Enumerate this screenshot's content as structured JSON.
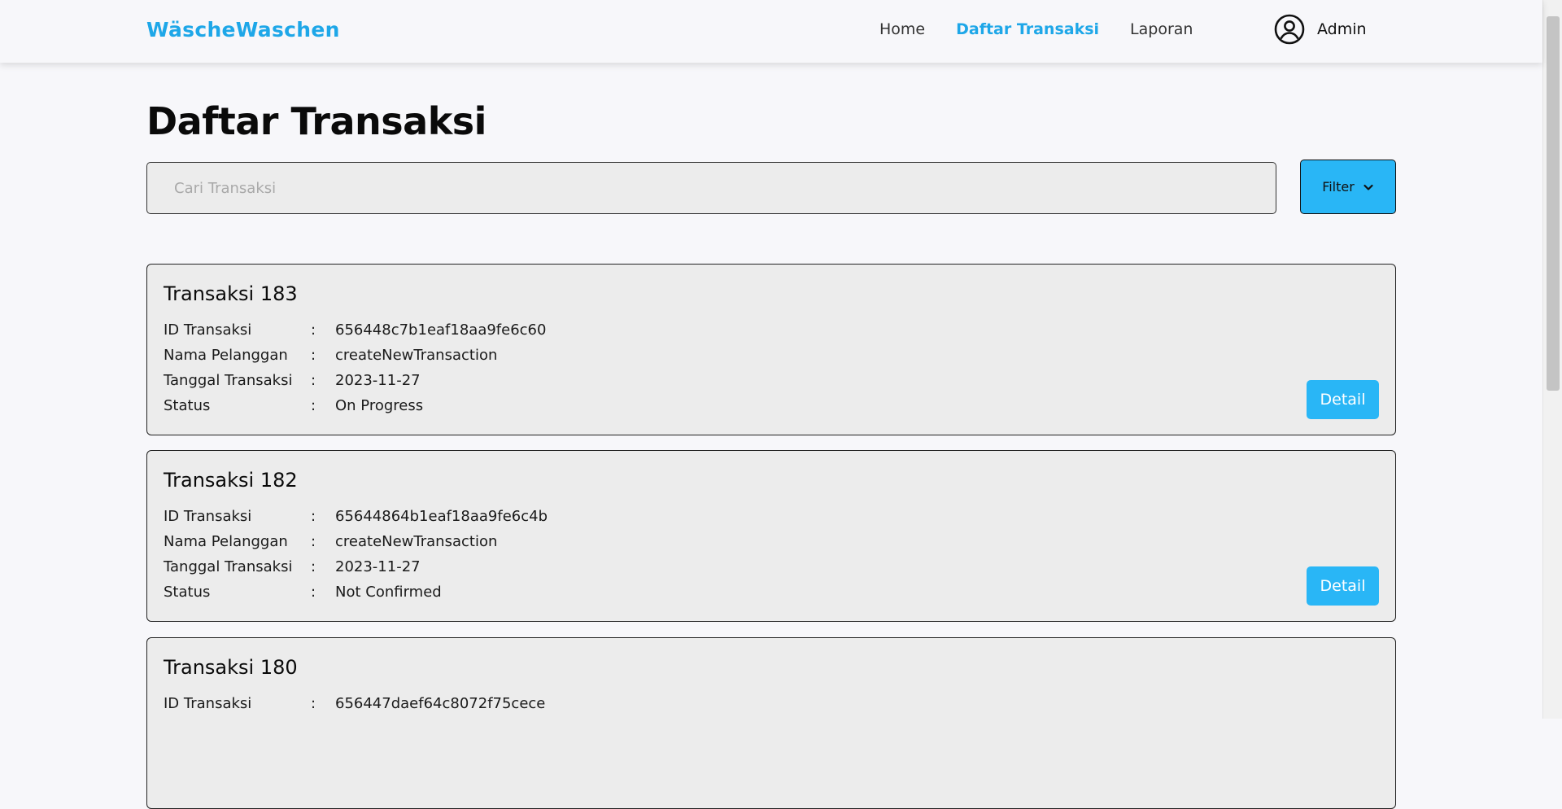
{
  "nav": {
    "brand": "WäscheWaschen",
    "links": [
      "Home",
      "Daftar Transaksi",
      "Laporan"
    ],
    "active_link": "Daftar Transaksi",
    "user": "Admin"
  },
  "page": {
    "title": "Daftar Transaksi",
    "search_placeholder": "Cari Transaksi",
    "filter_label": "Filter"
  },
  "labels": {
    "id": "ID Transaksi",
    "name": "Nama Pelanggan",
    "date": "Tanggal Transaksi",
    "status": "Status",
    "separator": ":",
    "detail_button": "Detail"
  },
  "transactions": [
    {
      "title": "Transaksi 183",
      "id": "656448c7b1eaf18aa9fe6c60",
      "name": "createNewTransaction",
      "date": "2023-11-27",
      "status": "On Progress"
    },
    {
      "title": "Transaksi 182",
      "id": "65644864b1eaf18aa9fe6c4b",
      "name": "createNewTransaction",
      "date": "2023-11-27",
      "status": "Not Confirmed"
    },
    {
      "title": "Transaksi 180",
      "id": "656447daef64c8072f75cece"
    }
  ],
  "colors": {
    "accent": "#1ea7e8",
    "button": "#29b6f6"
  }
}
